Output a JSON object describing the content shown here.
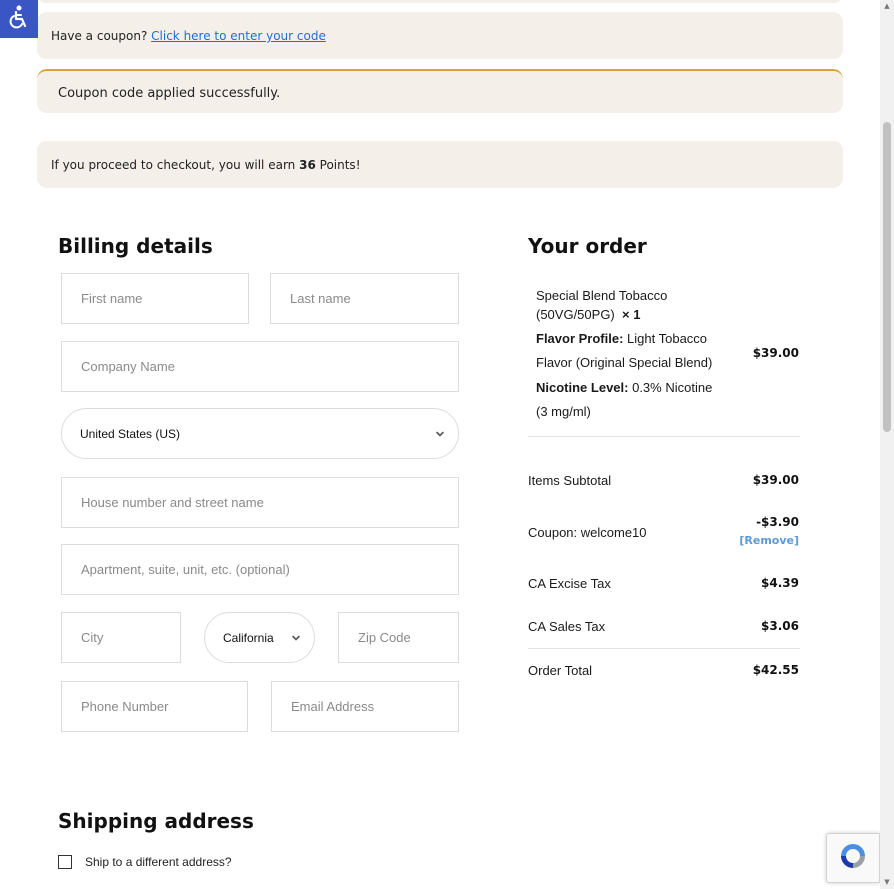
{
  "notices": {
    "coupon_prompt": "Have a coupon?",
    "coupon_link": "Click here to enter your code",
    "coupon_success": "Coupon code applied successfully.",
    "points_prefix": "If you proceed to checkout, you will earn",
    "points_value": "36",
    "points_suffix": "Points!"
  },
  "billing": {
    "title": "Billing details",
    "first_name_placeholder": "First name",
    "last_name_placeholder": "Last name",
    "company_placeholder": "Company Name",
    "country_value": "United States (US)",
    "street_placeholder": "House number and street name",
    "apartment_placeholder": "Apartment, suite, unit, etc. (optional)",
    "city_placeholder": "City",
    "state_value": "California",
    "zip_placeholder": "Zip Code",
    "phone_placeholder": "Phone Number",
    "email_placeholder": "Email Address"
  },
  "order": {
    "title": "Your order",
    "product": {
      "name_line1": "Special Blend Tobacco",
      "name_line2": "(50VG/50PG)",
      "qty": "× 1",
      "flavor_label": "Flavor Profile:",
      "flavor_value_line1": "Light Tobacco",
      "flavor_value_line2": "Flavor (Original Special Blend)",
      "nicotine_label": "Nicotine Level:",
      "nicotine_value_line1": "0.3% Nicotine",
      "nicotine_value_line2": "(3 mg/ml)",
      "price": "$39.00"
    },
    "subtotal_label": "Items Subtotal",
    "subtotal_value": "$39.00",
    "coupon_label": "Coupon: welcome10",
    "coupon_value": "-$3.90",
    "coupon_remove": "[Remove]",
    "excise_label": "CA Excise Tax",
    "excise_value": "$4.39",
    "sales_label": "CA Sales Tax",
    "sales_value": "$3.06",
    "total_label": "Order Total",
    "total_value": "$42.55"
  },
  "shipping": {
    "title": "Shipping address",
    "different_address_label": "Ship to a different address?"
  },
  "colors": {
    "notice_bg": "#f4efe9",
    "accent_link": "#1e6fd9",
    "success_border": "#d8a13a",
    "remove_link": "#5b9bd5",
    "a11y_button": "#3a56c4"
  },
  "icons": {
    "accessibility": "accessibility-icon",
    "chevron": "chevron-down-icon",
    "recaptcha": "recaptcha-icon"
  }
}
